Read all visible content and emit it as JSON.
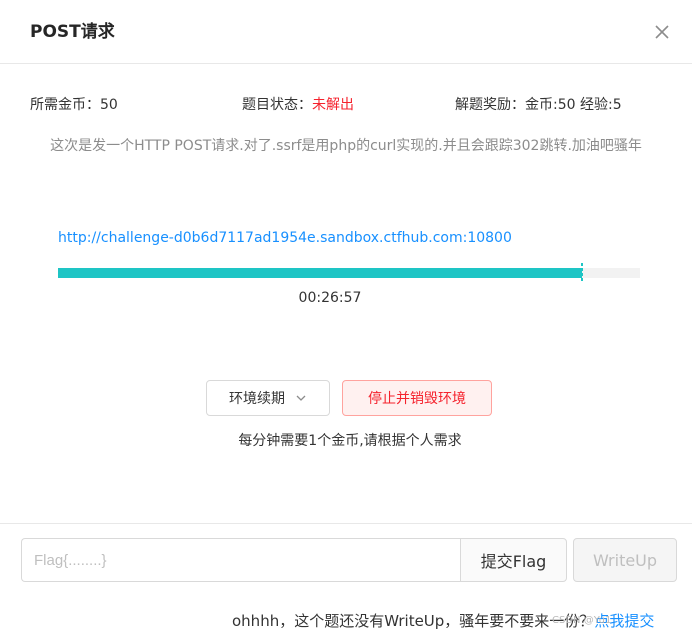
{
  "modal": {
    "title": "POST请求",
    "close_icon": "close-icon"
  },
  "info": {
    "coins": "所需金币：50",
    "status_label": "题目状态：",
    "status_value": "未解出",
    "reward": "解题奖励：金币:50 经验:5"
  },
  "description": "这次是发一个HTTP POST请求.对了.ssrf是用php的curl实现的.并且会跟踪302跳转.加油吧骚年",
  "environment": {
    "url": "http://challenge-d0b6d7117ad1954e.sandbox.ctfhub.com:10800",
    "remaining_fraction": 0.9,
    "timer": "00:26:57",
    "renew_label": "环境续期",
    "destroy_label": "停止并销毁环境",
    "note": "每分钟需要1个金币,请根据个人需求"
  },
  "flag": {
    "placeholder": "Flag{........}",
    "value": "",
    "submit_label": "提交Flag",
    "writeup_label": "WriteUp"
  },
  "footer": {
    "note": "ohhhh，这个题还没有WriteUp，骚年要不要来一份？",
    "link_label": "点我提交",
    "watermark": "CSDN @Yu1"
  },
  "colors": {
    "accent": "#1890ff",
    "progress": "#1ec5c5",
    "danger": "#f5222d"
  }
}
